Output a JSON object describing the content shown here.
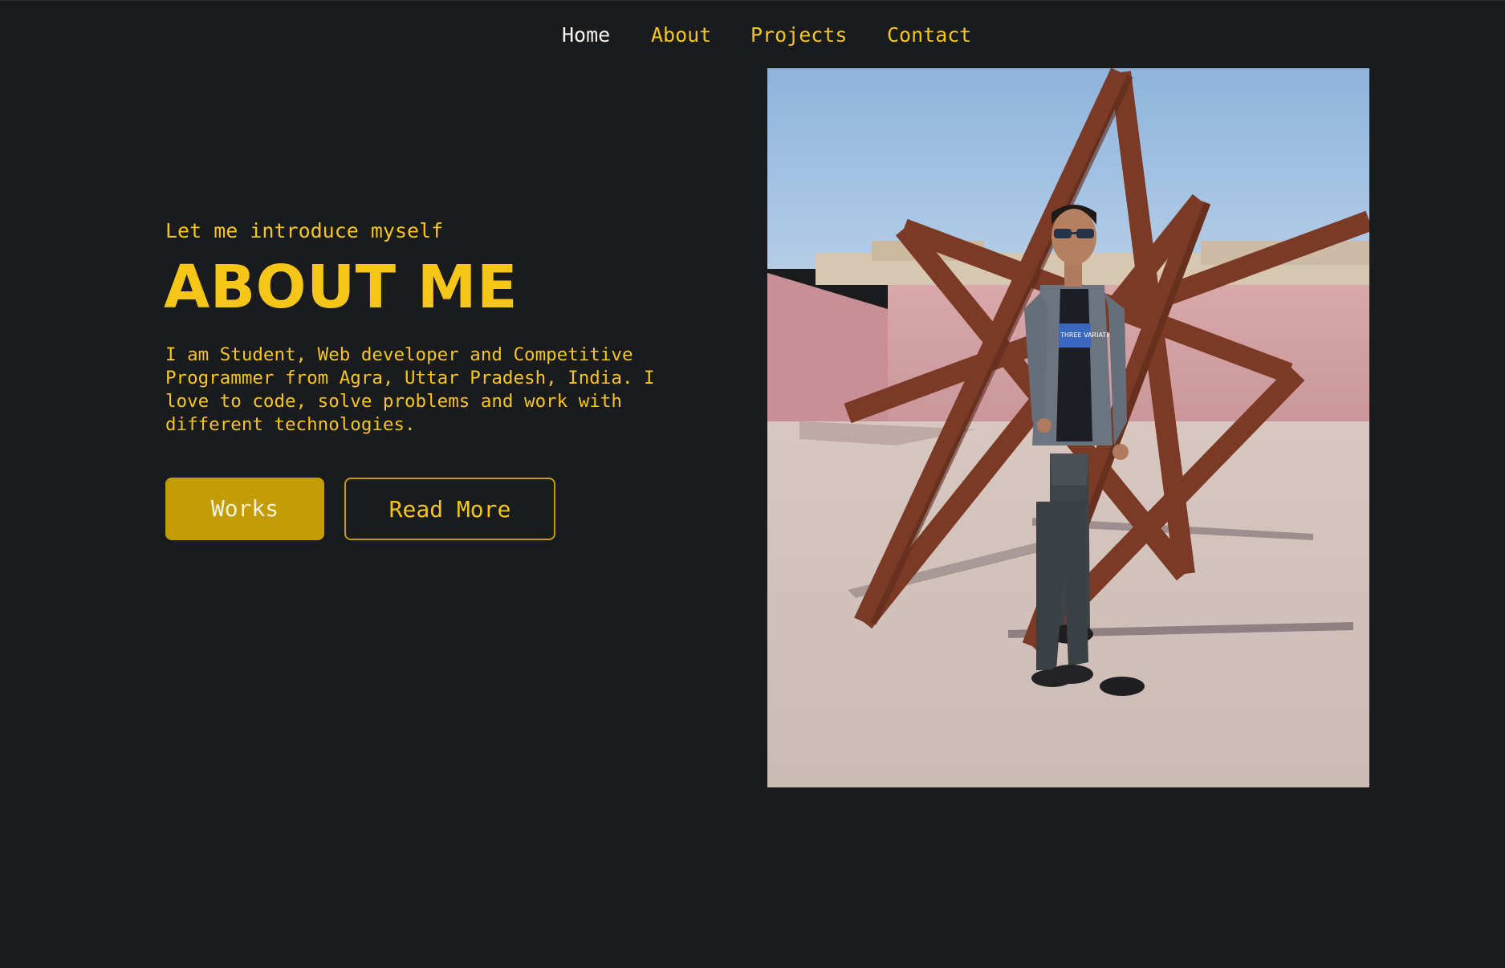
{
  "nav": {
    "items": [
      {
        "label": "Home",
        "active": true
      },
      {
        "label": "About",
        "active": false
      },
      {
        "label": "Projects",
        "active": false
      },
      {
        "label": "Contact",
        "active": false
      }
    ]
  },
  "hero": {
    "intro": "Let me introduce myself",
    "title": "ABOUT ME",
    "bio": "I am Student, Web developer and Competitive Programmer from Agra, Uttar Pradesh, India. I love to code, solve problems and work with different technologies.",
    "buttons": {
      "works": "Works",
      "read_more": "Read More"
    }
  },
  "photo": {
    "shirt_print": "THREE VARIATION"
  },
  "colors": {
    "background": "#1a1b1d",
    "accent": "#f5c518",
    "button_fill": "#c49c05",
    "nav_active": "#f2f2f2"
  }
}
